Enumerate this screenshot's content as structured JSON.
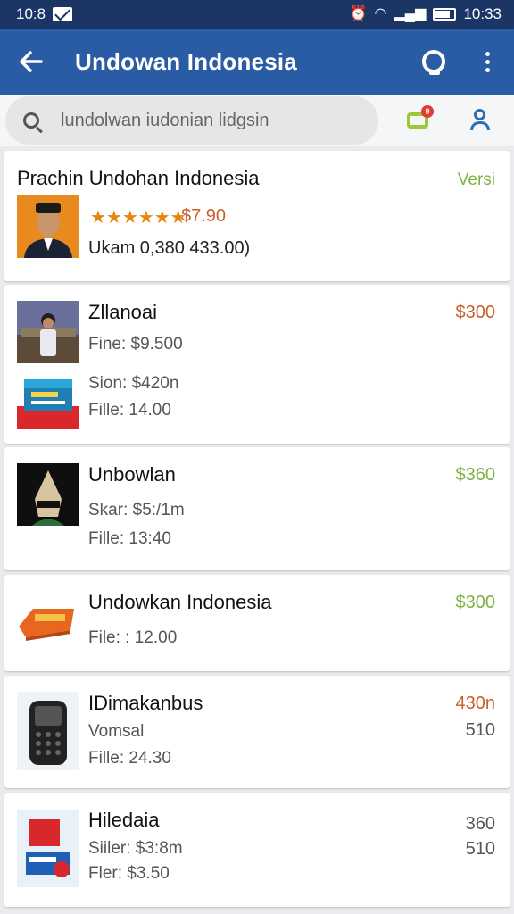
{
  "status_bar": {
    "time": "10:8",
    "clock_right": "10:33"
  },
  "app_bar": {
    "title": "Undowan Indonesia"
  },
  "search": {
    "value": "lundolwan iudonian lidgsin"
  },
  "notifications": {
    "badge_count": "9"
  },
  "colors": {
    "status_bar": "#1b3565",
    "app_bar": "#2a5ba5",
    "price_green": "#7cb342",
    "price_orange": "#c8602b",
    "star_orange": "#e8850f"
  },
  "items": [
    {
      "title": "Prachin Undohan Indonesia",
      "badge": "Versi",
      "rating_stars": "★★★★★★",
      "rating_price": "$7.90",
      "line": "Ukam 0,380 433.00)"
    },
    {
      "title": "Zllanoai",
      "price": "$300",
      "line1": "Fine: $9.500",
      "line2": "Sion: $420n",
      "line3": "Fille: 14.00"
    },
    {
      "title": "Unbowlan",
      "price": "$360",
      "line1": "Skar: $5:/1m",
      "line2": "Fille: 13:40"
    },
    {
      "title": "Undowkan Indonesia",
      "price": "$300",
      "line1": "File: : 12.00"
    },
    {
      "title": "IDimakanbus",
      "price": "430n",
      "price2": "510",
      "line1": "Vomsal",
      "line2": "Fille: 24.30"
    },
    {
      "title": "Hiledaia",
      "price": "360",
      "price2": "510",
      "line1": "Siiler: $3:8m",
      "line2": "Fler: $3.50"
    }
  ]
}
